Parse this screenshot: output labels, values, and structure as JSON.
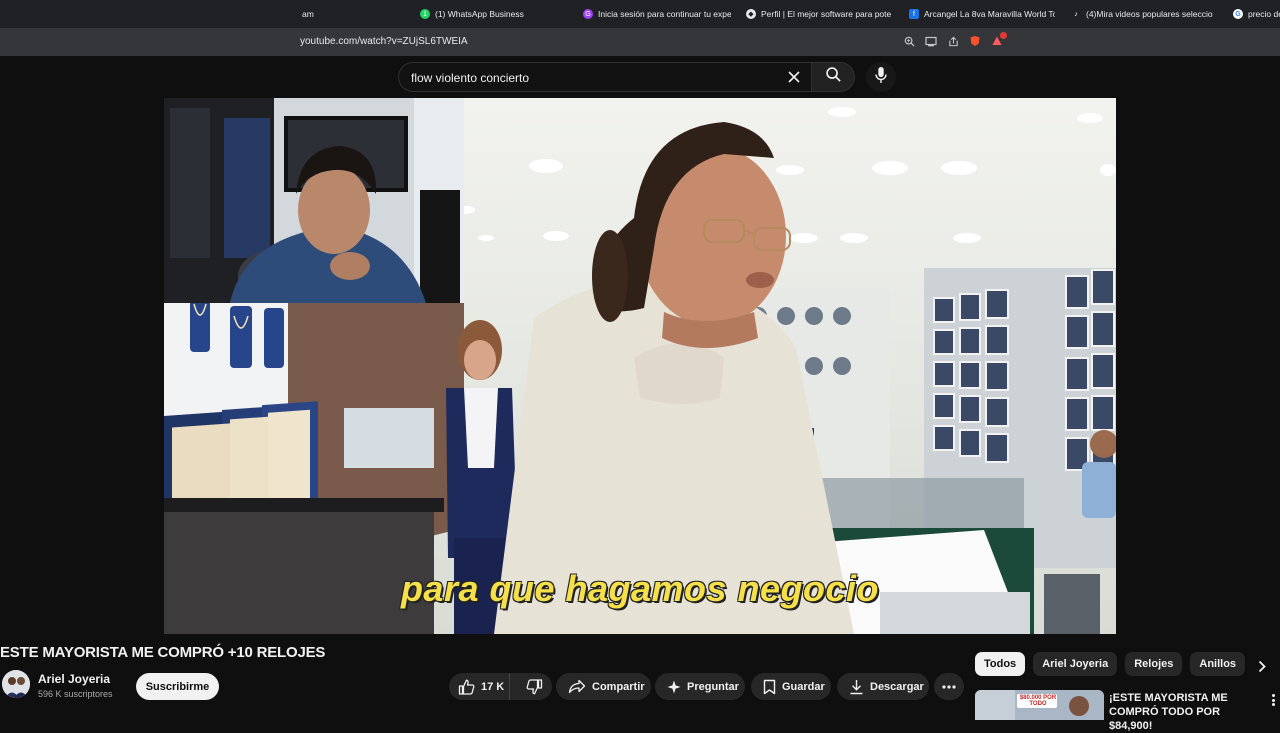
{
  "browser": {
    "tabs": [
      {
        "label": "am",
        "fav_color": "#202124",
        "fav_glyph": ""
      },
      {
        "label": "(1) WhatsApp Business",
        "fav_color": "#25d366",
        "fav_glyph": "1"
      },
      {
        "label": "Inicia sesión para continuar tu expe",
        "fav_color": "#a142f4",
        "fav_glyph": "G"
      },
      {
        "label": "Perfil | El mejor software para pote",
        "fav_color": "#e8eaed",
        "fav_glyph": "◆"
      },
      {
        "label": "Arcangel La 8va Maravilla World To",
        "fav_color": "#1a73e8",
        "fav_glyph": "f"
      },
      {
        "label": "(4)Mira videos populares seleccio",
        "fav_color": "#202124",
        "fav_glyph": "♪"
      },
      {
        "label": "precio de",
        "fav_color": "#ffffff",
        "fav_glyph": "G"
      }
    ],
    "url": "youtube.com/watch?v=ZUjSL6TWEIA",
    "address_icons": [
      "zoom-icon",
      "cast-icon",
      "share-icon",
      "brave-shield-icon",
      "rewards-icon"
    ]
  },
  "youtube": {
    "search": {
      "query": "flow violento concierto",
      "clear_icon": "close-icon",
      "search_icon": "search-icon",
      "mic_icon": "mic-icon"
    },
    "player": {
      "subtitle": "para que hagamos negocio"
    },
    "video": {
      "title": "ESTE MAYORISTA ME COMPRÓ +10 RELOJES",
      "channel": "Ariel Joyeria",
      "subscribers": "596 K suscriptores",
      "subscribe_label": "Suscribirme",
      "likes": "17 K",
      "actions": {
        "share": "Compartir",
        "ask": "Preguntar",
        "save": "Guardar",
        "download": "Descargar"
      }
    },
    "chips": [
      "Todos",
      "Ariel Joyeria",
      "Relojes",
      "Anillos"
    ],
    "recommendation": {
      "title": "¡ESTE MAYORISTA ME COMPRÓ TODO POR $84,900!",
      "thumb_text": "$80.000 POR TODO"
    }
  }
}
